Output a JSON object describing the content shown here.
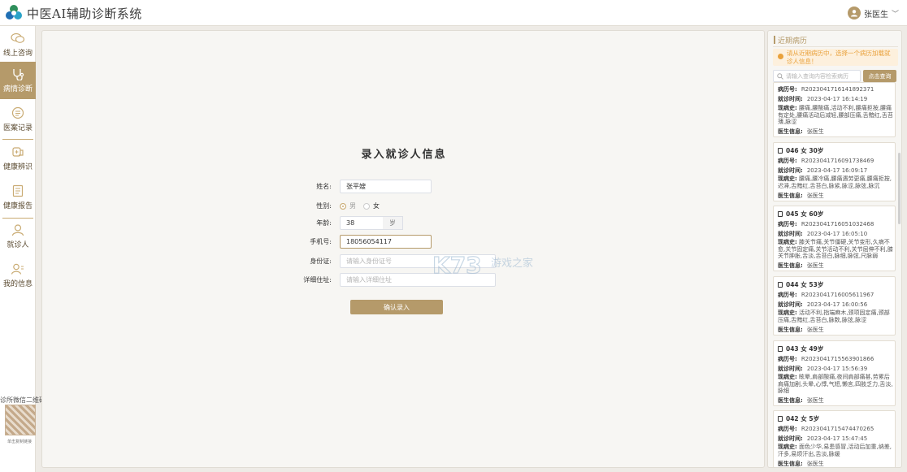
{
  "app": {
    "title": "中医AI辅助诊断系统"
  },
  "user": {
    "name": "张医生"
  },
  "nav": [
    {
      "label": "线上咨询",
      "icon": "chat-icon"
    },
    {
      "label": "病情诊断",
      "icon": "diagnosis-icon"
    },
    {
      "label": "医案记录",
      "icon": "record-icon"
    },
    {
      "label": "健康辨识",
      "icon": "health-icon"
    },
    {
      "label": "健康报告",
      "icon": "report-icon"
    },
    {
      "label": "就诊人",
      "icon": "patient-icon"
    },
    {
      "label": "我的信息",
      "icon": "profile-icon"
    }
  ],
  "qr": {
    "title": "诊所微信二维码",
    "caption": "单击复制链接"
  },
  "form": {
    "title": "录入就诊人信息",
    "name_label": "姓名:",
    "name_value": "张平嫂",
    "gender_label": "性别:",
    "gender_male": "男",
    "gender_female": "女",
    "gender_selected": "男",
    "age_label": "年龄:",
    "age_value": "38",
    "age_unit": "岁",
    "phone_label": "手机号:",
    "phone_value": "18056054117",
    "id_label": "身份证:",
    "id_placeholder": "请输入身份证号",
    "addr_label": "详细住址:",
    "addr_placeholder": "请输入详细住址",
    "submit": "确认录入"
  },
  "watermark": "K73 游戏之家",
  "right": {
    "title": "近期病历",
    "notice": "请从近期病历中，选择一个病历加载就诊人信息！",
    "search_placeholder": "请输入查询内容检索病历",
    "search_button": "点击查询",
    "labels": {
      "record_no": "病历号:",
      "visit_time": "就诊时间:",
      "history": "现病史:",
      "doctor": "医生信息:"
    },
    "records": [
      {
        "head": "",
        "record_no": "R20230417161418923​71",
        "visit_time": "2023-04-17 16:14:19",
        "history": "腰痛,腰酸痛,活动不利,腰痛拒按,腰痛有定处,腰痛活动后减轻,腰部压痛,舌黯红,舌苔薄,脉涩",
        "doctor": "张医生"
      },
      {
        "head": "046  女  30岁",
        "record_no": "R20230417160917384​69",
        "visit_time": "2023-04-17 16:09:17",
        "history": "腰痛,腰冷痛,腰痛遇劳更痛,腰痛拒按,迟滞,舌黯红,舌苔白,脉紧,脉涩,脉弦,脉沉",
        "doctor": "张医生"
      },
      {
        "head": "045  女  60岁",
        "record_no": "R20230417160510324​68",
        "visit_time": "2023-04-17 16:05:10",
        "history": "膝关节痛,关节僵硬,关节变形,久病不愈,关节固定痛,关节活动不利,关节屈伸不利,膝关节肿胀,舌淡,舌苔白,脉细,脉弦,尺脉弱",
        "doctor": "张医生"
      },
      {
        "head": "044  女  53岁",
        "record_no": "R20230417160056119​67",
        "visit_time": "2023-04-17 16:00:56",
        "history": "活动不利,指端麻木,颈项固定痛,颈部压痛,舌黯红,舌苔白,脉数,脉弦,脉涩",
        "doctor": "张医生"
      },
      {
        "head": "043  女  49岁",
        "record_no": "R20230417155639018​66",
        "visit_time": "2023-04-17 15:56:39",
        "history": "眩晕,肩部酸痛,夜间肩部痛甚,劳累后肩痛加剧,头晕,心悸,气短,懒言,四肢乏力,舌淡,脉细",
        "doctor": "张医生"
      },
      {
        "head": "042  女  5岁",
        "record_no": "R20230417154744702​65",
        "visit_time": "2023-04-17 15:47:45",
        "history": "面色少华,易患感冒,活动后加重,纳差,汗多,易烦汗出,舌淡,脉缓",
        "doctor": "张医生"
      }
    ]
  }
}
